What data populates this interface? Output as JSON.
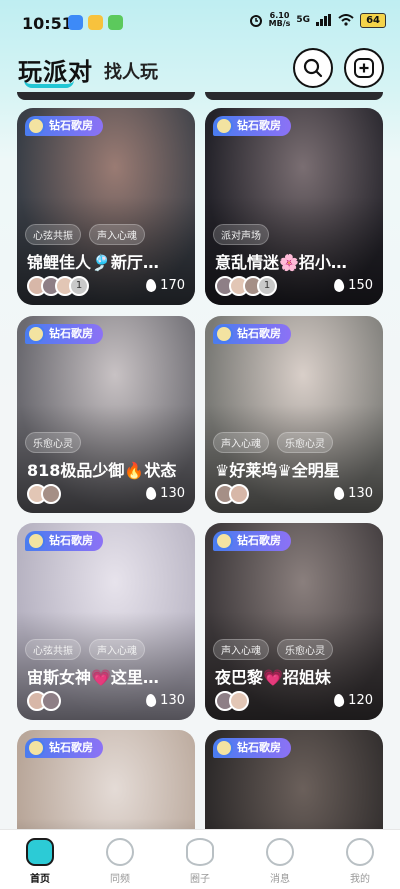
{
  "status_bar": {
    "time": "10:51",
    "net_speed_value": "6.10",
    "net_speed_unit": "MB/s",
    "network": "5G",
    "battery": "64",
    "icons": [
      "alarm-icon",
      "signal-icon",
      "wifi-icon"
    ]
  },
  "header": {
    "tabs": [
      {
        "label": "玩派对",
        "active": true
      },
      {
        "label": "找人玩",
        "active": false
      }
    ],
    "search_icon": "search-icon",
    "add_icon": "plus-icon"
  },
  "rooms": [
    {
      "badge": "钻石歌房",
      "tags": [
        "心弦共振",
        "声入心魂"
      ],
      "title": "锦鲤佳人🎐新厅…",
      "avatar_more": "1",
      "heat": "170",
      "colors": [
        "#3a3f47",
        "#9a7b73"
      ]
    },
    {
      "badge": "钻石歌房",
      "tags": [
        "派对声场"
      ],
      "title": "意乱情迷🌸招小…",
      "avatar_more": "1",
      "heat": "150",
      "colors": [
        "#24232a",
        "#7a6e72"
      ]
    },
    {
      "badge": "钻石歌房",
      "tags": [
        "乐愈心灵"
      ],
      "title": "818极品少御🔥状态",
      "avatar_more": "",
      "heat": "130",
      "colors": [
        "#6b6a70",
        "#c8c2c4"
      ]
    },
    {
      "badge": "钻石歌房",
      "tags": [
        "声入心魂",
        "乐愈心灵"
      ],
      "title": "♛好莱坞♛全明星",
      "avatar_more": "",
      "heat": "130",
      "colors": [
        "#7a7a76",
        "#d9cfc9"
      ]
    },
    {
      "badge": "钻石歌房",
      "tags": [
        "心弦共振",
        "声入心魂"
      ],
      "title": "宙斯女神💗这里…",
      "avatar_more": "",
      "heat": "130",
      "colors": [
        "#b7b3c2",
        "#e7e3ec"
      ]
    },
    {
      "badge": "钻石歌房",
      "tags": [
        "声入心魂",
        "乐愈心灵"
      ],
      "title": "夜巴黎💗招姐妹",
      "avatar_more": "",
      "heat": "120",
      "colors": [
        "#3f3a3c",
        "#8a7f7d"
      ]
    },
    {
      "badge": "钻石歌房",
      "tags": [],
      "title": "",
      "avatar_more": "",
      "heat": "",
      "colors": [
        "#b9a79a",
        "#e4dbd6"
      ]
    },
    {
      "badge": "钻石歌房",
      "tags": [],
      "title": "",
      "avatar_more": "",
      "heat": "",
      "colors": [
        "#2d2a2a",
        "#6b605b"
      ]
    }
  ],
  "bottom_nav": [
    {
      "label": "首页",
      "icon": "home-icon",
      "active": true
    },
    {
      "label": "同频",
      "icon": "vinyl-icon",
      "active": false
    },
    {
      "label": "圈子",
      "icon": "planet-icon",
      "active": false
    },
    {
      "label": "消息",
      "icon": "chat-bubble-icon",
      "active": false
    },
    {
      "label": "我的",
      "icon": "profile-face-icon",
      "active": false
    }
  ]
}
